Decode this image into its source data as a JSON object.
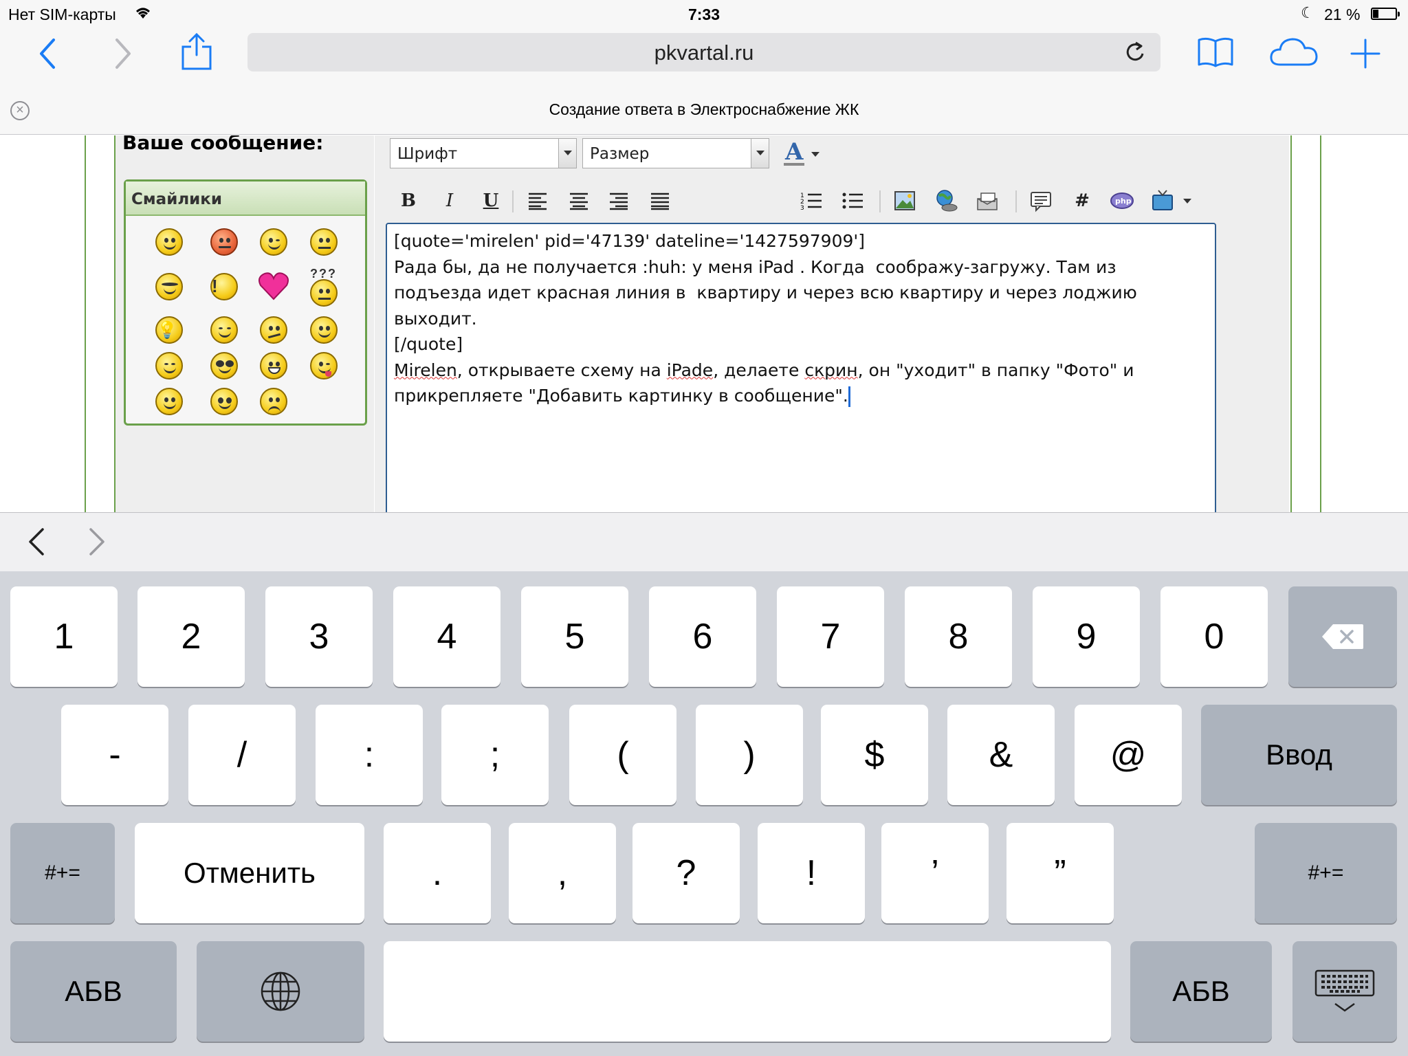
{
  "status_bar": {
    "carrier": "Нет SIM-карты",
    "time": "7:33",
    "battery": "21 %"
  },
  "browser": {
    "url": "pkvartal.ru",
    "icons": [
      "back-icon",
      "forward-icon",
      "share-icon",
      "reload-icon",
      "bookmarks-icon",
      "icloud-tabs-icon",
      "new-tab-icon"
    ]
  },
  "page_title": "Создание ответа в Электроснабжение ЖК",
  "left_panel": {
    "message_heading": "Ваше сообщение:",
    "smilies_heading": "Смайлики",
    "smilie_question": "???"
  },
  "editor": {
    "font_select": "Шрифт",
    "size_select": "Размер",
    "color_button": "A",
    "bold": "B",
    "italic": "I",
    "underline": "U",
    "hash": "#",
    "lines": [
      "[quote='mirelen' pid='47139' dateline='1427597909']",
      "",
      "Рада бы, да не получается :huh: у меня iPad . Когда  соображу-загружу. Там из",
      "подъезда идет красная линия в  квартиру и через всю квартиру и через лоджию",
      "выходит.",
      "[/quote]"
    ],
    "reply_line1_a": "Mirelen",
    "reply_line1_b": ", открываете схему на ",
    "reply_line1_c": "iPade",
    "reply_line1_d": ", делаете ",
    "reply_line1_e": "скрин",
    "reply_line1_f": ", он \"уходит\" в папку \"Фото\" и",
    "reply_line2": "прикрепляете \"Добавить картинку в сообщение\"."
  },
  "keyboard": {
    "row1": [
      "1",
      "2",
      "3",
      "4",
      "5",
      "6",
      "7",
      "8",
      "9",
      "0"
    ],
    "row2": [
      "-",
      "/",
      ":",
      ";",
      "(",
      ")",
      "$",
      "&",
      "@"
    ],
    "return": "Ввод",
    "more_symbols": "#+=",
    "undo": "Отменить",
    "row3": [
      ".",
      ",",
      "?",
      "!",
      "’",
      "”"
    ],
    "abc": "АБВ",
    "space": ""
  }
}
